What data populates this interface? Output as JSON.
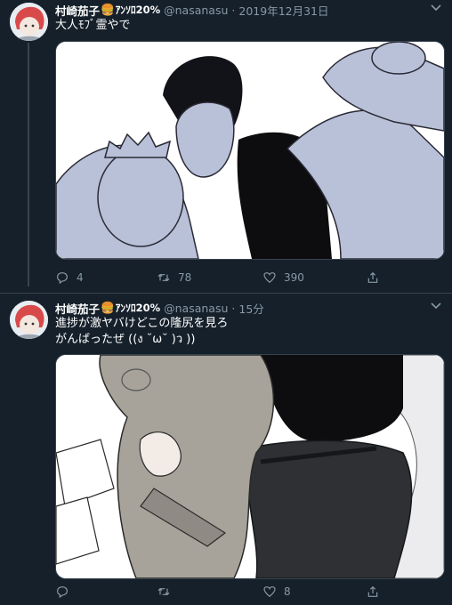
{
  "tweets": [
    {
      "author_name": "村崎茄子",
      "name_emoji": "🍔",
      "name_suffix": "ｱﾝｿﾛ20%",
      "handle": "@nasanasu",
      "separator": "·",
      "time": "2019年12月31日",
      "text": "大人ﾓﾌﾞ霊やで",
      "actions": {
        "reply": "4",
        "retweet": "78",
        "like": "390"
      }
    },
    {
      "author_name": "村崎茄子",
      "name_emoji": "🍔",
      "name_suffix": "ｱﾝｿﾛ20%",
      "handle": "@nasanasu",
      "separator": "·",
      "time": "15分",
      "text_line1": "進捗が激ヤバけどこの隆尻を見ろ",
      "text_line2": "がんばったぜ ((ง ˘ω˘ )ว ))",
      "actions": {
        "reply": "",
        "retweet": "",
        "like": "8"
      }
    }
  ],
  "icons": {
    "reply": "reply-icon",
    "retweet": "retweet-icon",
    "like": "heart-icon",
    "share": "share-icon",
    "menu": "chevron-down-icon"
  },
  "colors": {
    "background": "#15202b",
    "muted": "#8899a6",
    "border": "#38444d"
  }
}
